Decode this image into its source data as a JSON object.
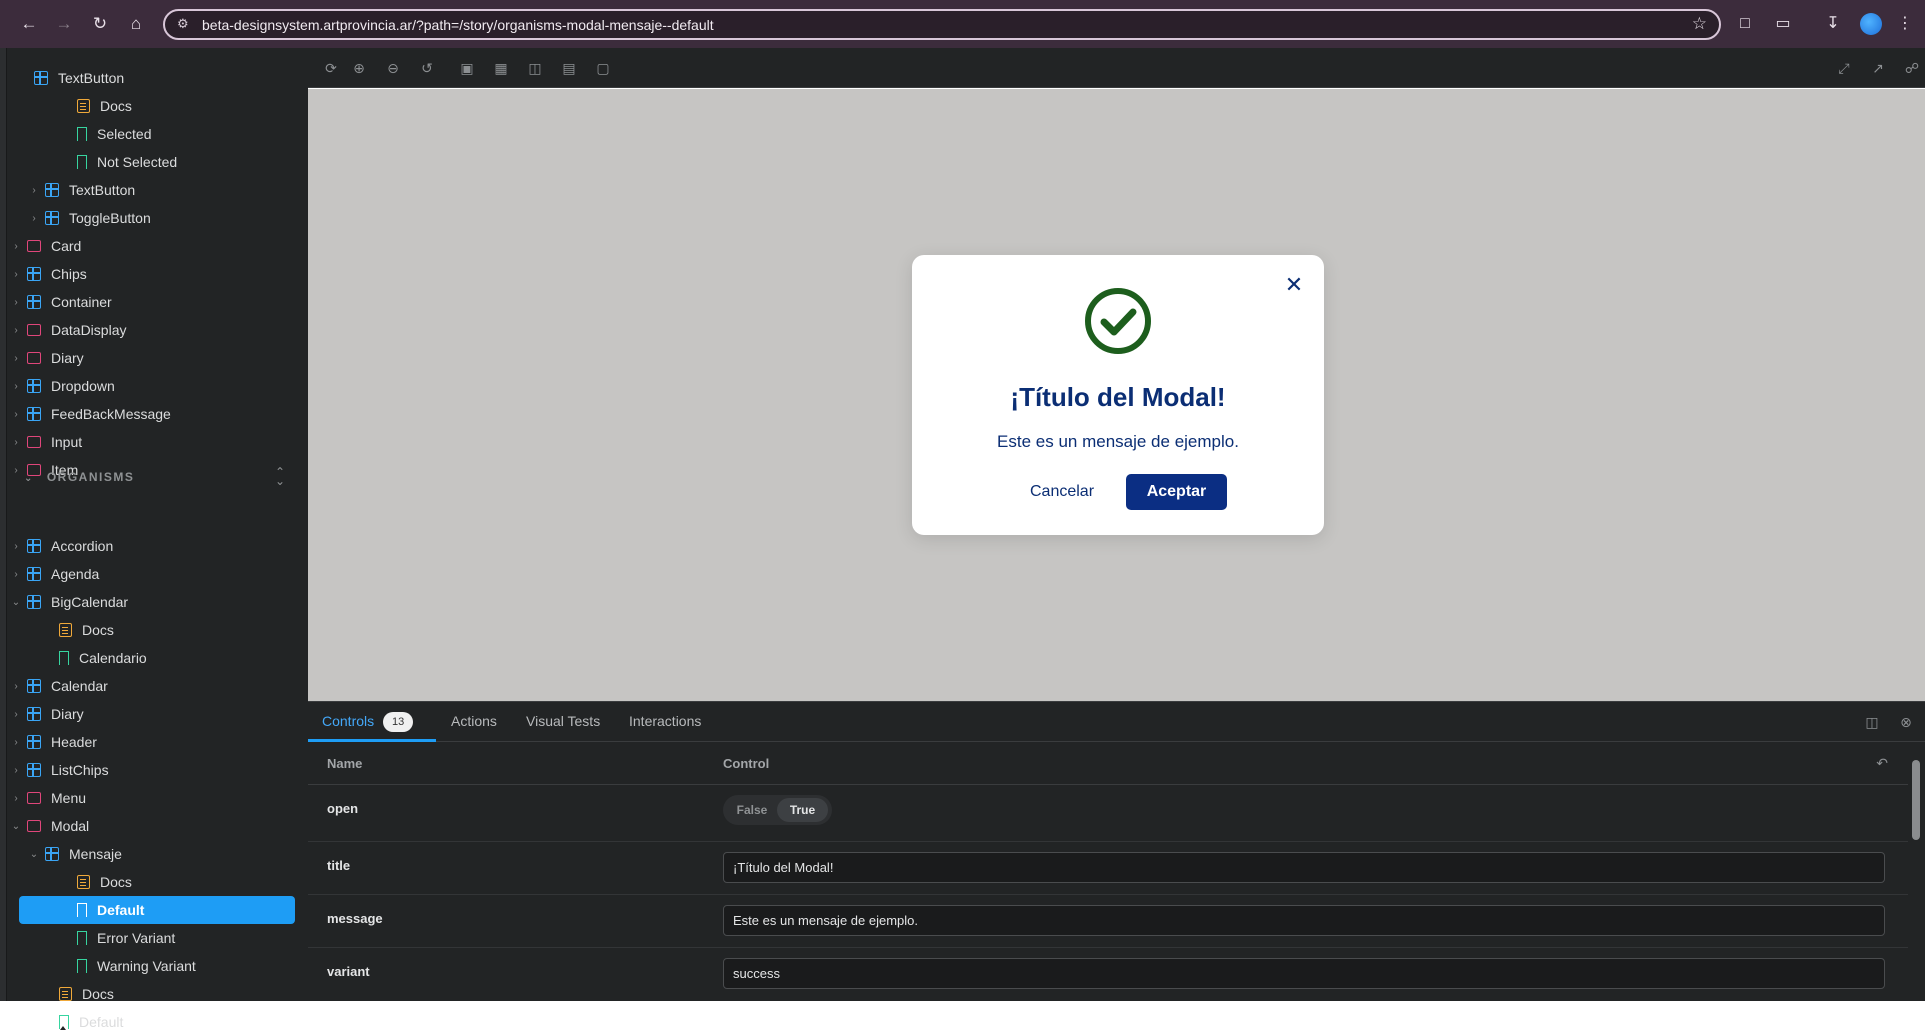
{
  "browser": {
    "url": "beta-designsystem.artprovincia.ar/?path=/story/organisms-modal-mensaje--default"
  },
  "sidebar": {
    "section_label": "ORGANISMS",
    "items": [
      {
        "label": "TextButton",
        "type": "comp",
        "partial": true
      },
      {
        "label": "Docs",
        "type": "doc"
      },
      {
        "label": "Selected",
        "type": "story"
      },
      {
        "label": "Not Selected",
        "type": "story"
      },
      {
        "label": "TextButton",
        "type": "comp"
      },
      {
        "label": "ToggleButton",
        "type": "comp"
      },
      {
        "label": "Card",
        "type": "folder"
      },
      {
        "label": "Chips",
        "type": "comp"
      },
      {
        "label": "Container",
        "type": "comp"
      },
      {
        "label": "DataDisplay",
        "type": "folder"
      },
      {
        "label": "Diary",
        "type": "folder"
      },
      {
        "label": "Dropdown",
        "type": "comp"
      },
      {
        "label": "FeedBackMessage",
        "type": "comp"
      },
      {
        "label": "Input",
        "type": "folder"
      },
      {
        "label": "Item",
        "type": "folder"
      },
      {
        "label": "Accordion",
        "type": "comp"
      },
      {
        "label": "Agenda",
        "type": "comp"
      },
      {
        "label": "BigCalendar",
        "type": "comp"
      },
      {
        "label": "Docs",
        "type": "doc"
      },
      {
        "label": "Calendario",
        "type": "story"
      },
      {
        "label": "Calendar",
        "type": "comp"
      },
      {
        "label": "Diary",
        "type": "comp"
      },
      {
        "label": "Header",
        "type": "comp"
      },
      {
        "label": "ListChips",
        "type": "comp"
      },
      {
        "label": "Menu",
        "type": "folder"
      },
      {
        "label": "Modal",
        "type": "folder"
      },
      {
        "label": "Mensaje",
        "type": "comp"
      },
      {
        "label": "Docs",
        "type": "doc"
      },
      {
        "label": "Default",
        "type": "story",
        "selected": true
      },
      {
        "label": "Error Variant",
        "type": "story"
      },
      {
        "label": "Warning Variant",
        "type": "story"
      },
      {
        "label": "Docs",
        "type": "doc"
      },
      {
        "label": "Default",
        "type": "story"
      }
    ]
  },
  "modal": {
    "title": "¡Título del Modal!",
    "message": "Este es un mensaje de ejemplo.",
    "cancel_label": "Cancelar",
    "accept_label": "Aceptar",
    "icon": "success-check-icon",
    "accent_color": "#0b2e74",
    "success_color": "#1d5e1d"
  },
  "addons": {
    "tabs": [
      "Controls",
      "Actions",
      "Visual Tests",
      "Interactions"
    ],
    "controls_count": "13",
    "col_name": "Name",
    "col_control": "Control",
    "controls": {
      "open": {
        "name": "open",
        "false_label": "False",
        "true_label": "True",
        "value": true
      },
      "title": {
        "name": "title",
        "value": "¡Título del Modal!"
      },
      "message": {
        "name": "message",
        "value": "Este es un mensaje de ejemplo."
      },
      "variant": {
        "name": "variant",
        "value": "success"
      }
    }
  }
}
